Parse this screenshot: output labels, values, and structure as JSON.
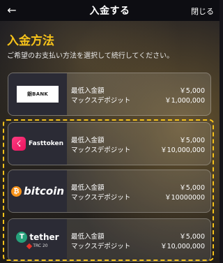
{
  "header": {
    "title": "入金する",
    "close_label": "閉じる",
    "back_icon": "arrow-left-icon"
  },
  "section": {
    "title": "入金方法",
    "subtitle": "ご希望のお支払い方法を選択して続行してください。"
  },
  "colors": {
    "accent": "#f6c21a",
    "fasttoken": "#ff3c82",
    "bitcoin": "#f7931a",
    "tether": "#26a17b"
  },
  "methods": [
    {
      "name": "BANK",
      "logo_text": "銀BANK",
      "min_label": "最低入金額",
      "max_label": "マックスデポジット",
      "min_value": "￥5,000",
      "max_value": "￥1,000,000"
    },
    {
      "name": "Fasttoken",
      "logo_text": "Fasttoken",
      "min_label": "最低入金額",
      "max_label": "マックスデポジット",
      "min_value": "￥5,000",
      "max_value": "￥10,000,000"
    },
    {
      "name": "bitcoin",
      "logo_text": "bitcoin",
      "min_label": "最低入金額",
      "max_label": "マックスデポジット",
      "min_value": "￥5,000",
      "max_value": "￥10000000"
    },
    {
      "name": "tether",
      "logo_text": "tether",
      "logo_sub": "TRC 20",
      "min_label": "最低入金額",
      "max_label": "マックスデポジット",
      "min_value": "￥5,000",
      "max_value": "￥10,000,000"
    }
  ]
}
